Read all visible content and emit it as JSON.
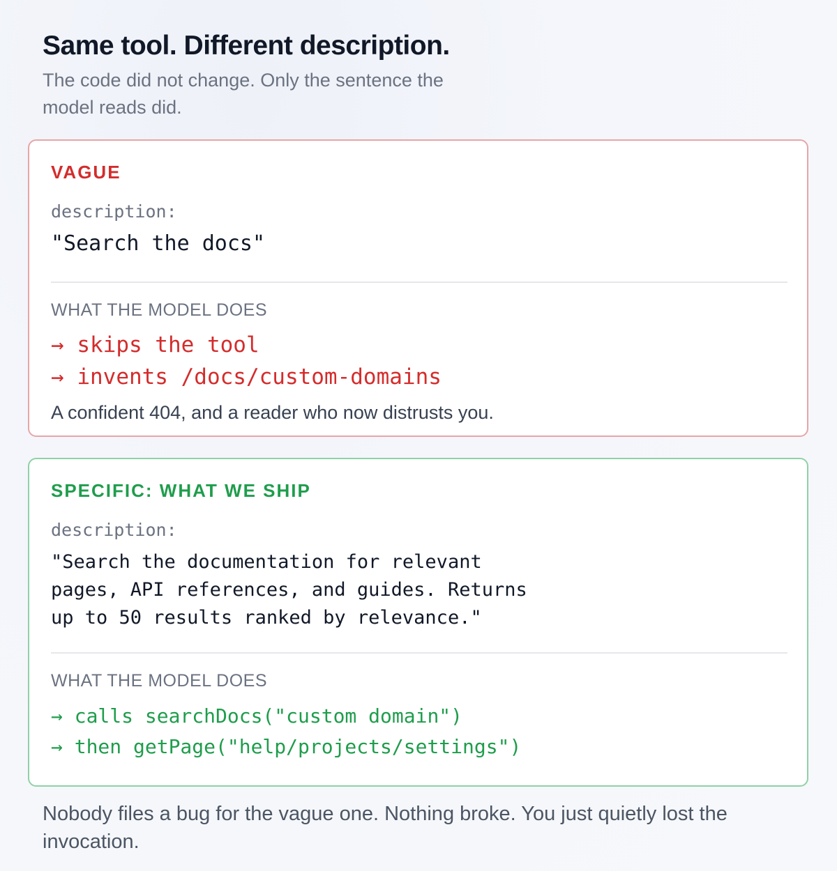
{
  "header": {
    "title": "Same tool. Different description.",
    "subtitle": "The code did not change. Only the sentence the model reads did."
  },
  "vague_card": {
    "label": "VAGUE",
    "description_key": "description:",
    "description_value": "\"Search the docs\"",
    "section_label": "WHAT THE MODEL DOES",
    "actions": [
      "→ skips the tool",
      "→ invents /docs/custom-domains"
    ],
    "consequence": "A confident 404, and a reader who now distrusts you.",
    "accent_color": "#d42c2c",
    "border_color": "#e8a5a5"
  },
  "specific_card": {
    "label": "SPECIFIC: WHAT WE SHIP",
    "description_key": "description:",
    "description_value": "\"Search the documentation for relevant\npages, API references, and guides. Returns\nup to 50 results ranked by relevance.\"",
    "section_label": "WHAT THE MODEL DOES",
    "actions": [
      "→ calls searchDocs(\"custom domain\")",
      "→ then getPage(\"help/projects/settings\")"
    ],
    "accent_color": "#1f9d4c",
    "border_color": "#8fd1a6"
  },
  "footer": {
    "text": "Nobody files a bug for the vague one. Nothing broke. You just quietly lost the invocation."
  }
}
